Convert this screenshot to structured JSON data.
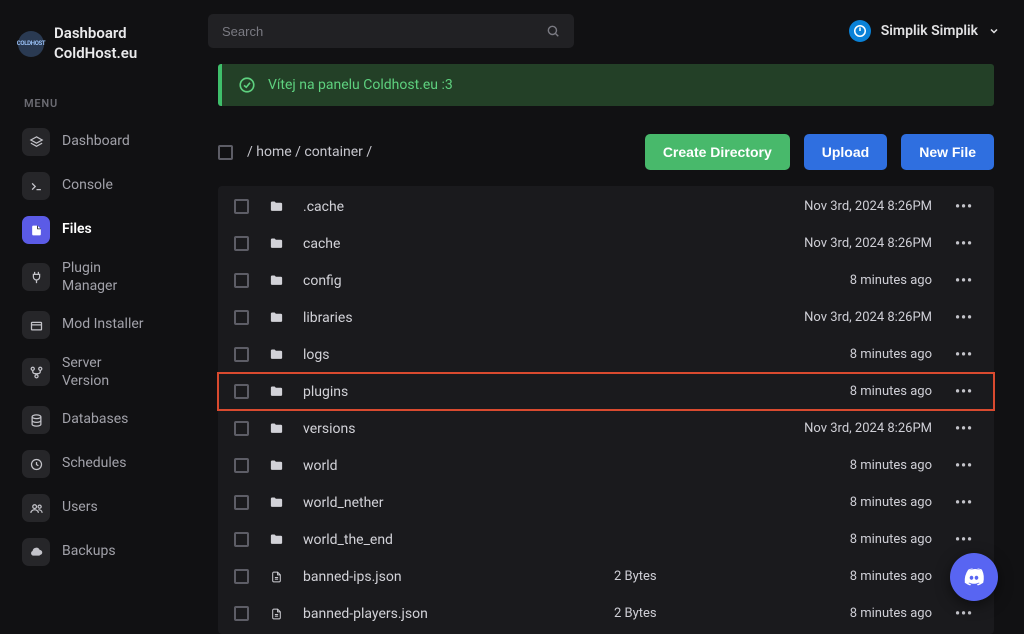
{
  "brand": {
    "line1": "Dashboard",
    "line2": "ColdHost.eu",
    "logo_text": "COLDHOST"
  },
  "menu_label": "MENU",
  "sidebar": {
    "items": [
      {
        "label": "Dashboard",
        "icon": "layers-icon"
      },
      {
        "label": "Console",
        "icon": "terminal-icon"
      },
      {
        "label": "Files",
        "icon": "file-icon"
      },
      {
        "label": "Plugin\nManager",
        "icon": "plug-icon"
      },
      {
        "label": "Mod Installer",
        "icon": "package-icon"
      },
      {
        "label": "Server\nVersion",
        "icon": "branch-icon"
      },
      {
        "label": "Databases",
        "icon": "database-icon"
      },
      {
        "label": "Schedules",
        "icon": "clock-icon"
      },
      {
        "label": "Users",
        "icon": "users-icon"
      },
      {
        "label": "Backups",
        "icon": "cloud-icon"
      }
    ]
  },
  "search": {
    "placeholder": "Search"
  },
  "user": {
    "name": "Simplik Simplik"
  },
  "banner": {
    "text": "Vítej na panelu Coldhost.eu :3"
  },
  "breadcrumb": "/ home / container /",
  "buttons": {
    "create_dir": "Create Directory",
    "upload": "Upload",
    "new_file": "New File"
  },
  "files": [
    {
      "type": "folder",
      "name": ".cache",
      "size": "",
      "date": "Nov 3rd, 2024 8:26PM",
      "highlight": false
    },
    {
      "type": "folder",
      "name": "cache",
      "size": "",
      "date": "Nov 3rd, 2024 8:26PM",
      "highlight": false
    },
    {
      "type": "folder",
      "name": "config",
      "size": "",
      "date": "8 minutes ago",
      "highlight": false
    },
    {
      "type": "folder",
      "name": "libraries",
      "size": "",
      "date": "Nov 3rd, 2024 8:26PM",
      "highlight": false
    },
    {
      "type": "folder",
      "name": "logs",
      "size": "",
      "date": "8 minutes ago",
      "highlight": false
    },
    {
      "type": "folder",
      "name": "plugins",
      "size": "",
      "date": "8 minutes ago",
      "highlight": true
    },
    {
      "type": "folder",
      "name": "versions",
      "size": "",
      "date": "Nov 3rd, 2024 8:26PM",
      "highlight": false
    },
    {
      "type": "folder",
      "name": "world",
      "size": "",
      "date": "8 minutes ago",
      "highlight": false
    },
    {
      "type": "folder",
      "name": "world_nether",
      "size": "",
      "date": "8 minutes ago",
      "highlight": false
    },
    {
      "type": "folder",
      "name": "world_the_end",
      "size": "",
      "date": "8 minutes ago",
      "highlight": false
    },
    {
      "type": "file",
      "name": "banned-ips.json",
      "size": "2 Bytes",
      "date": "8 minutes ago",
      "highlight": false
    },
    {
      "type": "file",
      "name": "banned-players.json",
      "size": "2 Bytes",
      "date": "8 minutes ago",
      "highlight": false
    }
  ]
}
